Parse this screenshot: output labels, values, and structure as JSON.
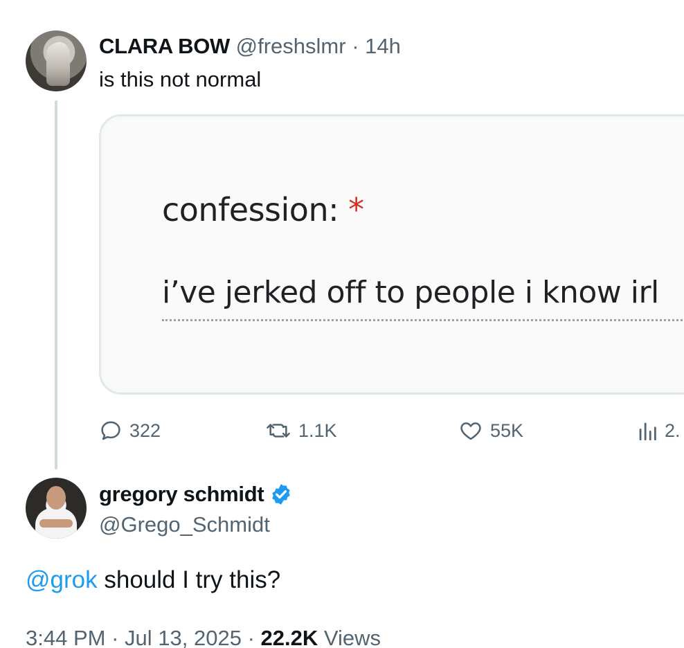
{
  "parent_tweet": {
    "display_name": "CLARA BOW",
    "handle": "@freshslmr",
    "separator": "·",
    "time_ago": "14h",
    "text": "is this not normal",
    "media": {
      "question_label": "confession:",
      "required_mark": "*",
      "answer_text": "i’ve jerked off to people i know irl"
    },
    "actions": {
      "replies": "322",
      "retweets": "1.1K",
      "likes": "55K",
      "views": "2."
    }
  },
  "reply_tweet": {
    "display_name": "gregory schmidt",
    "handle": "@Grego_Schmidt",
    "mention": "@grok",
    "text": " should I try this?",
    "time": "3:44 PM",
    "separator": "·",
    "date": "Jul 13, 2025",
    "views_count": "22.2K",
    "views_label": " Views"
  },
  "colors": {
    "text": "#0f1419",
    "muted": "#536471",
    "link": "#1d9bf0",
    "verified": "#1d9bf0",
    "required": "#d93025"
  },
  "icons": {
    "reply": "reply-icon",
    "retweet": "retweet-icon",
    "like": "heart-icon",
    "views": "views-icon",
    "verified": "verified-badge-icon"
  }
}
